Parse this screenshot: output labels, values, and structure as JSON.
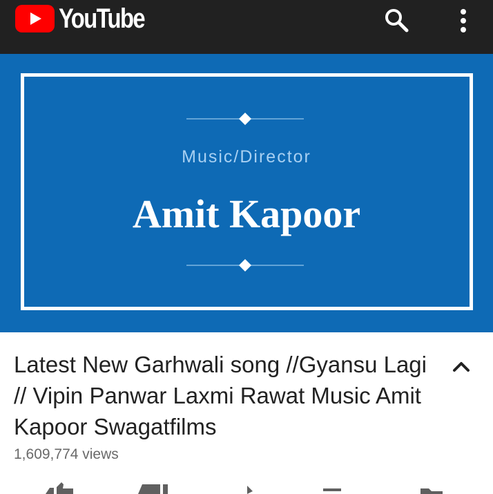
{
  "app": {
    "brand": "YouTube",
    "colors": {
      "topbar": "#212121",
      "logo_red": "#ff0000",
      "video_bg": "#0e6ab5"
    }
  },
  "header": {
    "icons": [
      "youtube-logo-icon",
      "search-icon",
      "more-vertical-icon"
    ]
  },
  "video_frame": {
    "subtitle": "Music/Director",
    "title": "Amit Kapoor"
  },
  "video_info": {
    "title": "Latest New Garhwali song //Gyansu Lagi // Vipin Panwar Laxmi Rawat Music Amit Kapoor Swagatfilms",
    "views": "1,609,774 views",
    "collapse_icon": "chevron-up-icon"
  },
  "action_bar": {
    "icons": [
      "like-icon",
      "dislike-icon",
      "share-icon",
      "add-to-playlist-icon",
      "download-icon"
    ]
  }
}
